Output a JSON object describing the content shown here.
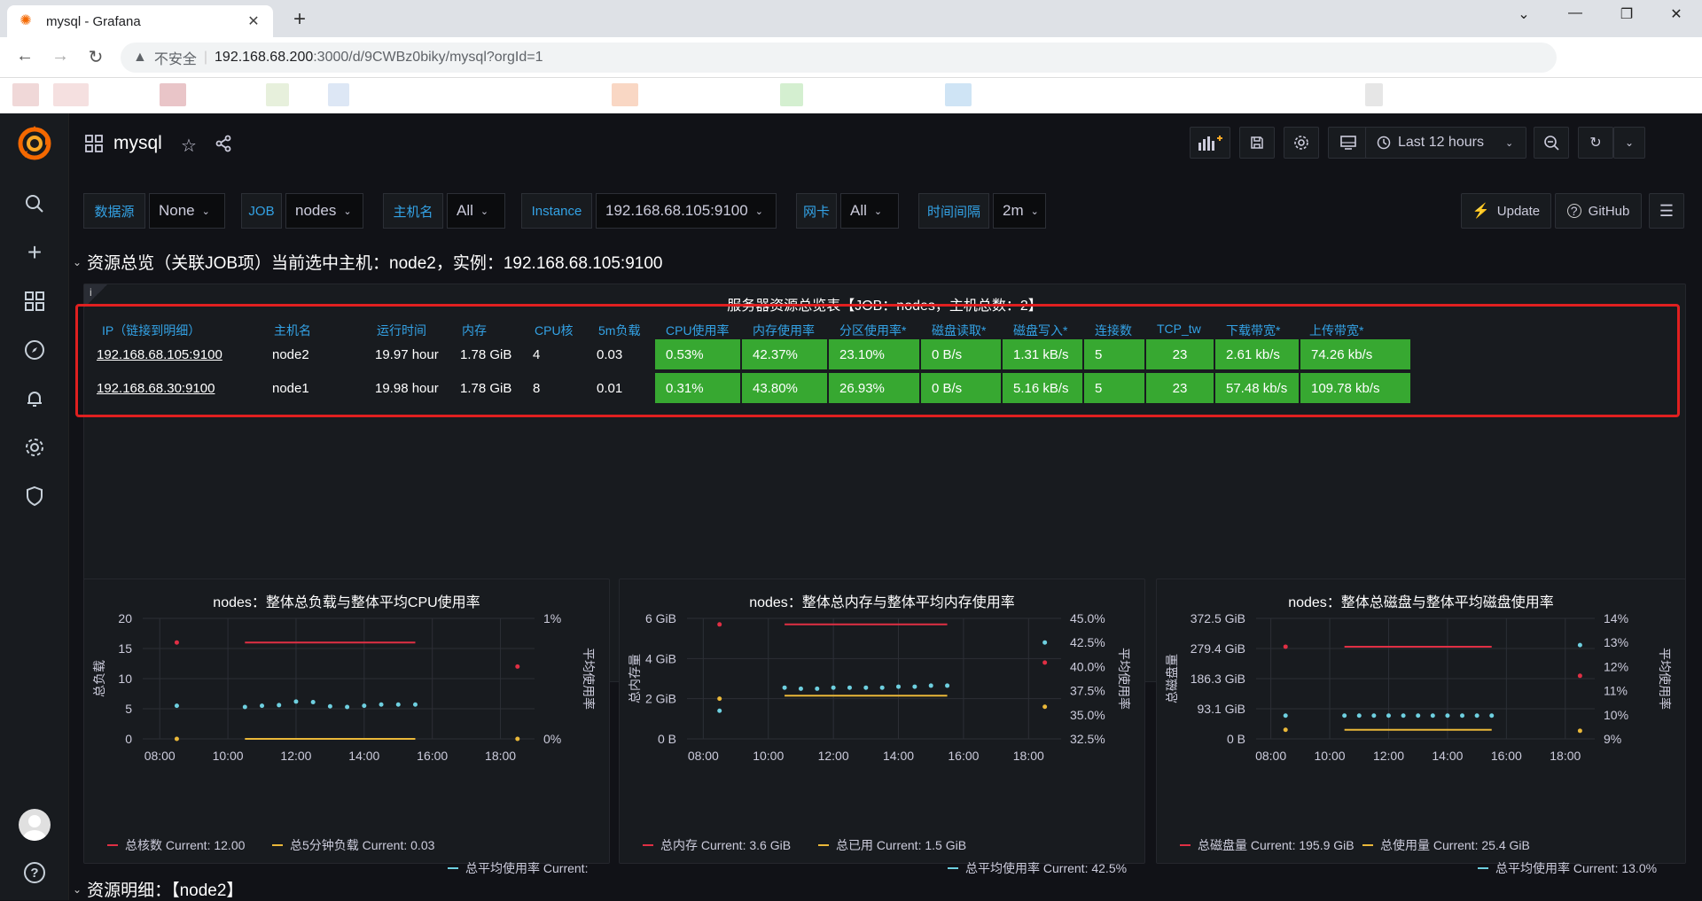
{
  "browser": {
    "tab_title": "mysql - Grafana",
    "insecure_label": "不安全",
    "url_host": "192.168.68.200",
    "url_rest": ":3000/d/9CWBz0biky/mysql?orgId=1"
  },
  "dashboard": {
    "title": "mysql",
    "time_range": "Last 12 hours",
    "update_label": "Update",
    "github_label": "GitHub"
  },
  "variables": [
    {
      "label": "数据源",
      "value": "None"
    },
    {
      "label": "JOB",
      "value": "nodes"
    },
    {
      "label": "主机名",
      "value": "All"
    },
    {
      "label": "Instance",
      "value": "192.168.68.105:9100"
    },
    {
      "label": "网卡",
      "value": "All"
    },
    {
      "label": "时间间隔",
      "value": "2m"
    }
  ],
  "row1_title": "资源总览（关联JOB项）当前选中主机：node2，实例：192.168.68.105:9100",
  "row2_title": "资源明细：【node2】",
  "table_panel": {
    "title": "服务器资源总览表【JOB：nodes，主机总数：2】",
    "info_icon": "i",
    "headers": [
      "IP（链接到明细）",
      "主机名",
      "运行时间",
      "内存",
      "CPU核",
      "5m负载",
      "CPU使用率",
      "内存使用率",
      "分区使用率*",
      "磁盘读取*",
      "磁盘写入*",
      "连接数",
      "TCP_tw",
      "下载带宽*",
      "上传带宽*"
    ],
    "rows": [
      [
        "192.168.68.105:9100",
        "node2",
        "19.97 hour",
        "1.78 GiB",
        "4",
        "0.03",
        "0.53%",
        "42.37%",
        "23.10%",
        "0 B/s",
        "1.31 kB/s",
        "5",
        "23",
        "2.61 kb/s",
        "74.26 kb/s"
      ],
      [
        "192.168.68.30:9100",
        "node1",
        "19.98 hour",
        "1.78 GiB",
        "8",
        "0.01",
        "0.31%",
        "43.80%",
        "26.93%",
        "0 B/s",
        "5.16 kB/s",
        "5",
        "23",
        "57.48 kb/s",
        "109.78 kb/s"
      ]
    ]
  },
  "chart_data": [
    {
      "type": "scatter",
      "title": "nodes：整体总负载与整体平均CPU使用率",
      "ylabel": "总负载",
      "y2label": "平均使用率",
      "x_ticks": [
        "08:00",
        "10:00",
        "12:00",
        "14:00",
        "16:00",
        "18:00"
      ],
      "y_ticks": [
        "20",
        "15",
        "10",
        "5",
        "0"
      ],
      "y2_ticks": [
        "1%",
        "0%"
      ],
      "ylim": [
        0,
        20
      ],
      "series": [
        {
          "name": "总核数",
          "legend": "总核数  Current: 12.00",
          "color": "#e02f44",
          "points": [
            [
              8.5,
              16
            ],
            [
              18.5,
              12
            ]
          ],
          "line": [
            [
              10.5,
              16
            ],
            [
              15.5,
              16
            ]
          ]
        },
        {
          "name": "总5分钟负载",
          "legend": "总5分钟负载  Current: 0.03",
          "color": "#eab839",
          "points": [
            [
              8.5,
              0
            ],
            [
              18.5,
              0
            ]
          ],
          "line": [
            [
              10.5,
              0
            ],
            [
              15.5,
              0
            ]
          ]
        },
        {
          "name": "总平均使用率",
          "legend": "总平均使用率  Current:",
          "color": "#6ed0e0",
          "points": [
            [
              8.5,
              5.5
            ],
            [
              10.5,
              5.3
            ],
            [
              11,
              5.5
            ],
            [
              11.5,
              5.6
            ],
            [
              12,
              6.2
            ],
            [
              12.5,
              6.1
            ],
            [
              13,
              5.4
            ],
            [
              13.5,
              5.3
            ],
            [
              14,
              5.5
            ],
            [
              14.5,
              5.7
            ],
            [
              15,
              5.7
            ],
            [
              15.5,
              5.7
            ]
          ]
        }
      ]
    },
    {
      "type": "scatter",
      "title": "nodes：整体总内存与整体平均内存使用率",
      "ylabel": "总内存量",
      "y2label": "平均使用率",
      "x_ticks": [
        "08:00",
        "10:00",
        "12:00",
        "14:00",
        "16:00",
        "18:00"
      ],
      "y_ticks": [
        "6 GiB",
        "4 GiB",
        "2 GiB",
        "0 B"
      ],
      "y2_ticks": [
        "45.0%",
        "42.5%",
        "40.0%",
        "37.5%",
        "35.0%",
        "32.5%"
      ],
      "ylim": [
        0,
        6
      ],
      "series": [
        {
          "name": "总内存",
          "legend": "总内存  Current: 3.6 GiB",
          "color": "#e02f44",
          "points": [
            [
              8.5,
              5.7
            ],
            [
              18.5,
              3.8
            ]
          ],
          "line": [
            [
              10.5,
              5.7
            ],
            [
              15.5,
              5.7
            ]
          ]
        },
        {
          "name": "总已用",
          "legend": "总已用  Current: 1.5 GiB",
          "color": "#eab839",
          "points": [
            [
              8.5,
              2.0
            ],
            [
              18.5,
              1.6
            ]
          ],
          "line": [
            [
              10.5,
              2.15
            ],
            [
              15.5,
              2.15
            ]
          ]
        },
        {
          "name": "总平均使用率",
          "legend": "总平均使用率  Current: 42.5%",
          "color": "#6ed0e0",
          "points": [
            [
              8.5,
              1.4
            ],
            [
              10.5,
              2.55
            ],
            [
              11,
              2.5
            ],
            [
              11.5,
              2.5
            ],
            [
              12,
              2.55
            ],
            [
              12.5,
              2.55
            ],
            [
              13,
              2.55
            ],
            [
              13.5,
              2.55
            ],
            [
              14,
              2.6
            ],
            [
              14.5,
              2.6
            ],
            [
              15,
              2.65
            ],
            [
              15.5,
              2.65
            ],
            [
              18.5,
              4.8
            ]
          ]
        }
      ]
    },
    {
      "type": "scatter",
      "title": "nodes：整体总磁盘与整体平均磁盘使用率",
      "ylabel": "总磁盘量",
      "y2label": "平均使用率",
      "x_ticks": [
        "08:00",
        "10:00",
        "12:00",
        "14:00",
        "16:00",
        "18:00"
      ],
      "y_ticks": [
        "372.5 GiB",
        "279.4 GiB",
        "186.3 GiB",
        "93.1 GiB",
        "0 B"
      ],
      "y2_ticks": [
        "14%",
        "13%",
        "12%",
        "11%",
        "10%",
        "9%"
      ],
      "ylim": [
        0,
        372.5
      ],
      "series": [
        {
          "name": "总磁盘量",
          "legend": "总磁盘量  Current: 195.9 GiB",
          "color": "#e02f44",
          "points": [
            [
              8.5,
              285
            ],
            [
              18.5,
              195
            ]
          ],
          "line": [
            [
              10.5,
              285
            ],
            [
              15.5,
              285
            ]
          ]
        },
        {
          "name": "总使用量",
          "legend": "总使用量  Current: 25.4 GiB",
          "color": "#eab839",
          "points": [
            [
              8.5,
              28
            ],
            [
              18.5,
              25
            ]
          ],
          "line": [
            [
              10.5,
              28
            ],
            [
              15.5,
              28
            ]
          ]
        },
        {
          "name": "总平均使用率",
          "legend": "总平均使用率  Current: 13.0%",
          "color": "#6ed0e0",
          "points": [
            [
              8.5,
              72
            ],
            [
              10.5,
              72
            ],
            [
              11,
              72
            ],
            [
              11.5,
              72
            ],
            [
              12,
              72
            ],
            [
              12.5,
              72
            ],
            [
              13,
              72
            ],
            [
              13.5,
              72
            ],
            [
              14,
              72
            ],
            [
              14.5,
              72
            ],
            [
              15,
              72
            ],
            [
              15.5,
              72
            ],
            [
              18.5,
              290
            ]
          ]
        }
      ]
    }
  ]
}
